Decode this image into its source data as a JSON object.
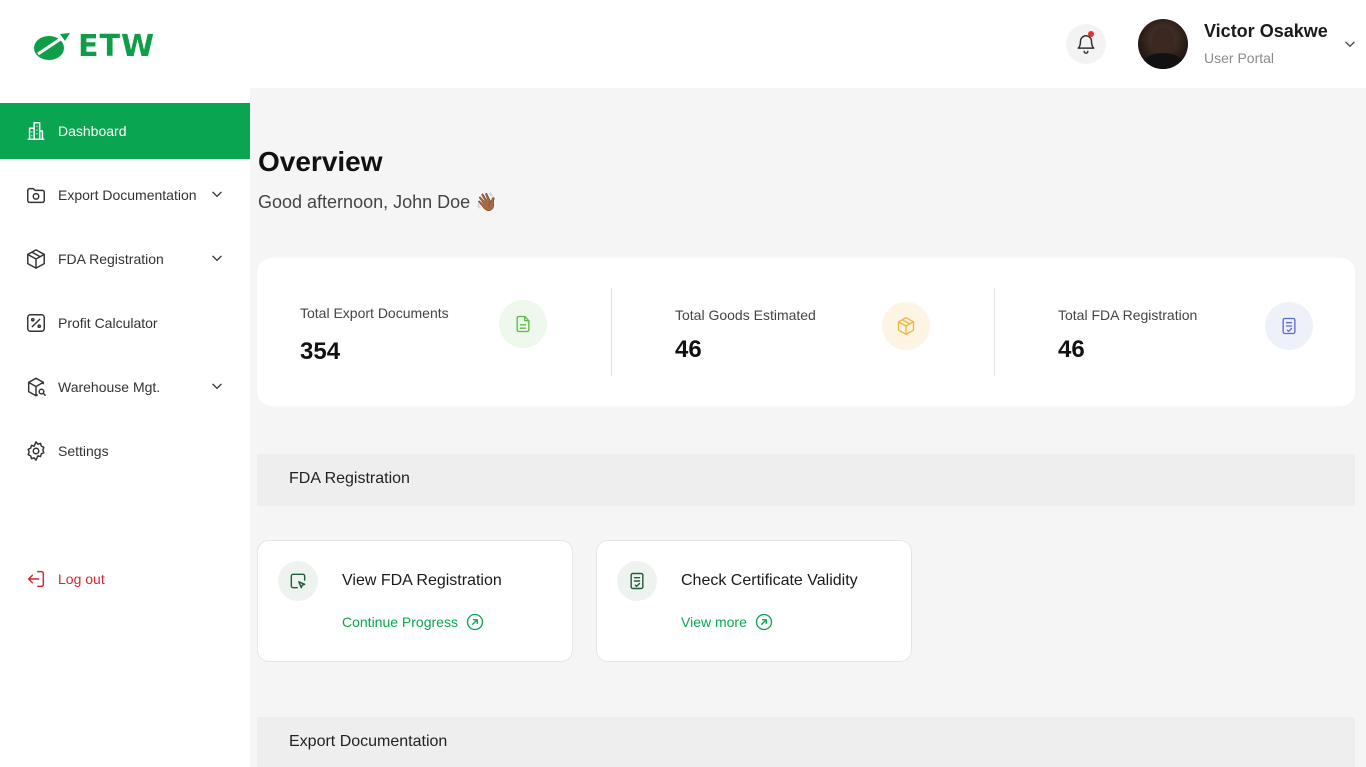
{
  "brand": {
    "name": "ETW",
    "color": "#0f9d47"
  },
  "header": {
    "user_name": "Victor Osakwe",
    "user_role": "User Portal"
  },
  "sidebar": {
    "items": [
      {
        "label": "Dashboard",
        "icon": "building-icon",
        "active": true
      },
      {
        "label": "Export Documentation",
        "icon": "folder-camera-icon",
        "has_submenu": true
      },
      {
        "label": "FDA Registration",
        "icon": "package-icon",
        "has_submenu": true
      },
      {
        "label": "Profit Calculator",
        "icon": "percent-calculator-icon"
      },
      {
        "label": "Warehouse Mgt.",
        "icon": "box-search-icon",
        "has_submenu": true
      },
      {
        "label": "Settings",
        "icon": "gear-icon"
      }
    ],
    "logout_label": "Log out"
  },
  "main": {
    "title": "Overview",
    "greeting": "Good afternoon, John Doe 👋🏾",
    "stats": [
      {
        "label": "Total Export Documents",
        "value": "354",
        "icon": "document-icon",
        "icon_bg": "#eef8ec",
        "icon_color": "#5fb84c"
      },
      {
        "label": "Total Goods Estimated",
        "value": "46",
        "icon": "box-icon",
        "icon_bg": "#fdf4e3",
        "icon_color": "#f0b53a"
      },
      {
        "label": "Total FDA Registration",
        "value": "46",
        "icon": "checklist-icon",
        "icon_bg": "#eef0fa",
        "icon_color": "#5a6bd0"
      }
    ],
    "fda_section": {
      "title": "FDA Registration",
      "cards": [
        {
          "title": "View FDA Registration",
          "link": "Continue Progress",
          "icon": "cursor-window-icon"
        },
        {
          "title": "Check Certificate Validity",
          "link": "View more",
          "icon": "certificate-check-icon"
        }
      ]
    },
    "export_section": {
      "title": "Export Documentation"
    }
  },
  "colors": {
    "accent": "#0aa550",
    "danger": "#d8242f",
    "main_bg": "#f5f5f5"
  }
}
